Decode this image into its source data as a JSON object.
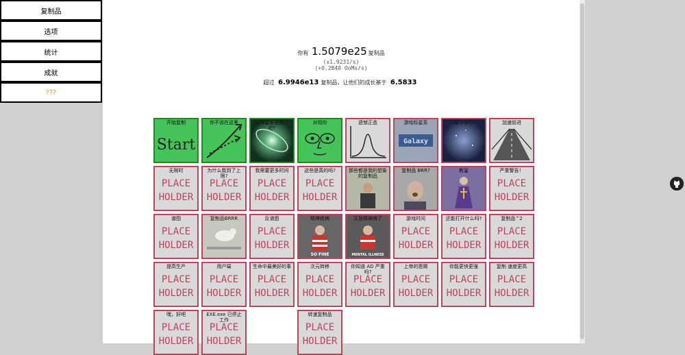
{
  "nav": {
    "items": [
      "复制品",
      "选项",
      "统计",
      "成就",
      "???"
    ]
  },
  "stats": {
    "you_have": "你有",
    "replicanti": "1.5079e25",
    "replicanti_unit": "复制品",
    "rate": "(x1.9231/s)",
    "ooms": "(+0.2840 OoMs/s)",
    "exceed_prefix": "超过",
    "exceed_value": "6.9946e13",
    "exceed_mid": "复制品，让他们的成长基于",
    "exceed_base": "6.5833"
  },
  "placeholder": [
    "PLACE",
    "HOLDER"
  ],
  "upgrades": [
    {
      "name": "开始复制",
      "state": "bought",
      "art": "start"
    },
    {
      "name": "你不该在这里",
      "state": "bought",
      "art": "arrows"
    },
    {
      "name": "获得星系更快了吧?",
      "state": "bought",
      "art": "galaxy-photo"
    },
    {
      "name": "对视你",
      "state": "bought",
      "art": "eyes"
    },
    {
      "name": "遗憾正态",
      "state": "locked",
      "art": "bell-curve"
    },
    {
      "name": "游戏标星系",
      "state": "locked",
      "art": "galaxy-sign"
    },
    {
      "name": "缓冲银心",
      "state": "locked",
      "art": "nebula"
    },
    {
      "name": "加速前进",
      "state": "locked",
      "art": "road"
    },
    {
      "name": "无限时",
      "state": "locked",
      "art": "ph"
    },
    {
      "name": "为什么我到了上限?",
      "state": "locked",
      "art": "ph"
    },
    {
      "name": "我需要更多时间",
      "state": "locked",
      "art": "ph"
    },
    {
      "name": "这些是真的吗?",
      "state": "locked",
      "art": "ph"
    },
    {
      "name": "那些都是我的想象的复制品",
      "state": "locked",
      "art": "man-chair"
    },
    {
      "name": "复制品 BRR?",
      "state": "locked",
      "art": "man-shout"
    },
    {
      "name": "教皇",
      "state": "locked",
      "art": "priest"
    },
    {
      "name": "严重警告！",
      "state": "locked",
      "art": "ph"
    },
    {
      "name": "谱图",
      "state": "locked",
      "art": "ph"
    },
    {
      "name": "复制品BRRR",
      "state": "locked",
      "art": "dog"
    },
    {
      "name": "反谱图",
      "state": "locked",
      "art": "ph"
    },
    {
      "name": "精神疾病",
      "state": "locked",
      "art": "so-fine"
    },
    {
      "name": "又是精神病了",
      "state": "locked",
      "art": "mental-illness"
    },
    {
      "name": "游戏时间",
      "state": "locked",
      "art": "ph"
    },
    {
      "name": "还能打开什么吗?",
      "state": "locked",
      "art": "ph"
    },
    {
      "name": "复制品^2",
      "state": "locked",
      "art": "ph"
    },
    {
      "name": "提高生产",
      "state": "locked",
      "art": "ph"
    },
    {
      "name": "用户端",
      "state": "locked",
      "art": "ph"
    },
    {
      "name": "生命中最美好的事",
      "state": "locked",
      "art": "ph"
    },
    {
      "name": "次元转移",
      "state": "locked",
      "art": "ph"
    },
    {
      "name": "你知道 AD 严重吗?",
      "state": "locked",
      "art": "ph"
    },
    {
      "name": "上帝的恩赐",
      "state": "locked",
      "art": "ph"
    },
    {
      "name": "你能更快更强",
      "state": "locked",
      "art": "ph"
    },
    {
      "name": "复制 速度更高",
      "state": "locked",
      "art": "ph"
    },
    {
      "name": "嘿，好吧",
      "state": "locked",
      "art": "ph"
    },
    {
      "name": "EXE.exe 已停止工作",
      "state": "locked",
      "art": "ph"
    },
    {
      "name": "",
      "state": "empty",
      "art": "none"
    },
    {
      "name": "转速复制品",
      "state": "locked",
      "art": "ph"
    }
  ],
  "art_text": {
    "galaxy_sign": "Galaxy",
    "so_fine": "SO FINE",
    "mental_illness": "MENTAL ILLNESS",
    "start": "Start"
  },
  "colors": {
    "bought_bg": "#45c45a",
    "bought_border": "#1e8a1e",
    "locked_border": "#c0415a",
    "locked_bg": "#d9d9d9",
    "secret_text": "#e0a020"
  }
}
